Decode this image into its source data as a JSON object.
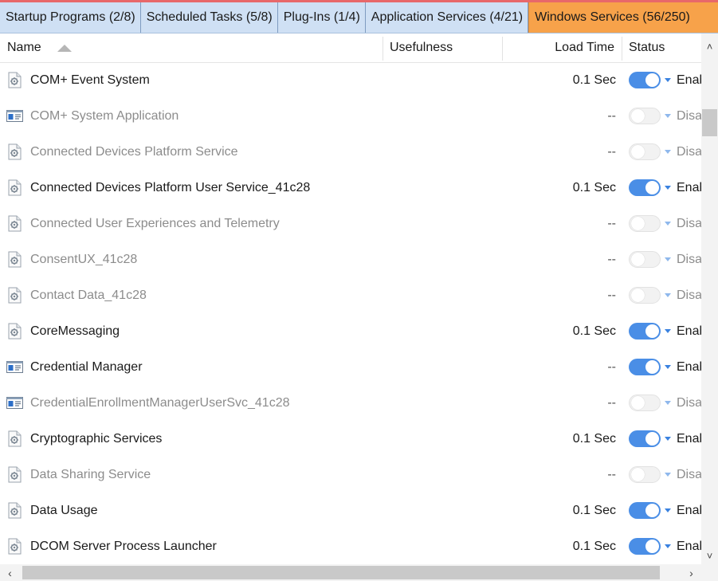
{
  "tabs": [
    {
      "label": "Startup Programs (2/8)"
    },
    {
      "label": "Scheduled Tasks (5/8)"
    },
    {
      "label": "Plug-Ins (1/4)"
    },
    {
      "label": "Application Services (4/21)"
    },
    {
      "label": "Windows Services (56/250)"
    }
  ],
  "columns": {
    "name": "Name",
    "usefulness": "Usefulness",
    "load_time": "Load Time",
    "status": "Status"
  },
  "colors": {
    "active_tab": "#f7a24a",
    "tab_bar": "#cfe0f4",
    "toggle_on": "#4a8ee6"
  },
  "rows": [
    {
      "name": "COM+ Event System",
      "load_time": "0.1 Sec",
      "status": "Enab",
      "enabled": true,
      "icon": "gear-service-icon"
    },
    {
      "name": "COM+ System Application",
      "load_time": "--",
      "status": "Disa",
      "enabled": false,
      "icon": "window-service-icon"
    },
    {
      "name": "Connected Devices Platform Service",
      "load_time": "--",
      "status": "Disa",
      "enabled": false,
      "icon": "gear-service-icon"
    },
    {
      "name": "Connected Devices Platform User Service_41c28",
      "load_time": "0.1 Sec",
      "status": "Enab",
      "enabled": true,
      "icon": "gear-service-icon"
    },
    {
      "name": "Connected User Experiences and Telemetry",
      "load_time": "--",
      "status": "Disa",
      "enabled": false,
      "icon": "gear-service-icon"
    },
    {
      "name": "ConsentUX_41c28",
      "load_time": "--",
      "status": "Disa",
      "enabled": false,
      "icon": "gear-service-icon"
    },
    {
      "name": "Contact Data_41c28",
      "load_time": "--",
      "status": "Disa",
      "enabled": false,
      "icon": "gear-service-icon"
    },
    {
      "name": "CoreMessaging",
      "load_time": "0.1 Sec",
      "status": "Enab",
      "enabled": true,
      "icon": "gear-service-icon"
    },
    {
      "name": "Credential Manager",
      "load_time": "--",
      "status": "Enab",
      "enabled": true,
      "icon": "window-service-icon"
    },
    {
      "name": "CredentialEnrollmentManagerUserSvc_41c28",
      "load_time": "--",
      "status": "Disa",
      "enabled": false,
      "icon": "window-service-icon"
    },
    {
      "name": "Cryptographic Services",
      "load_time": "0.1 Sec",
      "status": "Enab",
      "enabled": true,
      "icon": "gear-service-icon"
    },
    {
      "name": "Data Sharing Service",
      "load_time": "--",
      "status": "Disa",
      "enabled": false,
      "icon": "gear-service-icon"
    },
    {
      "name": "Data Usage",
      "load_time": "0.1 Sec",
      "status": "Enab",
      "enabled": true,
      "icon": "gear-service-icon"
    },
    {
      "name": "DCOM Server Process Launcher",
      "load_time": "0.1 Sec",
      "status": "Enab",
      "enabled": true,
      "icon": "gear-service-icon"
    }
  ]
}
